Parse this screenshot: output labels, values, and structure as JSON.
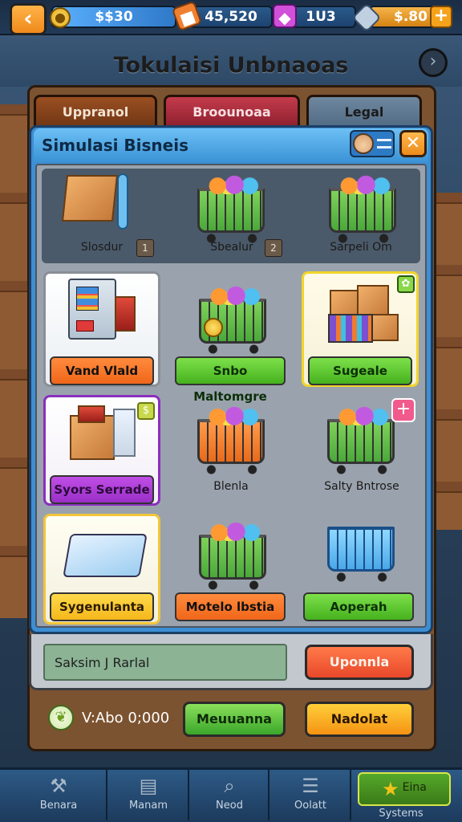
{
  "topbar": {
    "coins": "$$30",
    "crates": "45,520",
    "gems": "1U3",
    "gold": "$.80"
  },
  "page": {
    "title": "Tokulaisi Unbnaoas"
  },
  "tabs": [
    {
      "label": "Uppranol"
    },
    {
      "label": "Broounoaa"
    },
    {
      "label": "Legal"
    }
  ],
  "panel": {
    "title": "Simulasi Bisneis"
  },
  "top_items": [
    {
      "label": "Slosdur",
      "badge": "1"
    },
    {
      "label": "Sbealur",
      "badge": "2"
    },
    {
      "label": "Sarpeli Om"
    }
  ],
  "cards": [
    {
      "label": "Vand Vlald"
    },
    {
      "label": "Snbo Maltomgre"
    },
    {
      "label": "Sugeale"
    },
    {
      "label": "Syors Serrade"
    },
    {
      "label": "Blenla"
    },
    {
      "label": "Salty Bntrose"
    },
    {
      "label": "Sygenulanta"
    },
    {
      "label": "Motelo lbstia"
    },
    {
      "label": "Aoperah"
    }
  ],
  "search": {
    "value": "Saksim J Rarlal"
  },
  "actions": {
    "upgrade": "Uponnla",
    "value_label": "V:Abo 0;000",
    "manage": "Meuuanna",
    "nadolat": "Nadolat"
  },
  "bottom_nav": [
    {
      "label": "Benara"
    },
    {
      "label": "Manam"
    },
    {
      "label": "Neod"
    },
    {
      "label": "Oolatt"
    },
    {
      "label": "Systems",
      "active_text": "Eina"
    }
  ],
  "colors": {
    "accent_orange": "#f08a1c",
    "panel_blue": "#3d8ed3",
    "green": "#46b21e",
    "purple": "#9a2fc7",
    "yellow": "#f5b71c"
  }
}
